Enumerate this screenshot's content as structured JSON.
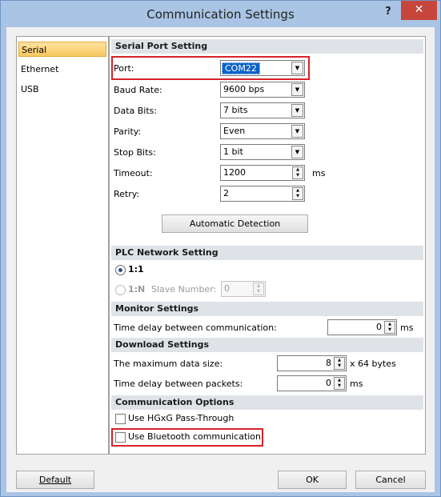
{
  "window": {
    "title": "Communication Settings",
    "help": "?",
    "close": "✕"
  },
  "nav": {
    "items": [
      "Serial",
      "Ethernet",
      "USB"
    ],
    "selected": "Serial"
  },
  "serial": {
    "header": "Serial Port Setting",
    "port_label": "Port:",
    "port_value": "COM22",
    "baud_label": "Baud Rate:",
    "baud_value": "9600 bps",
    "databits_label": "Data Bits:",
    "databits_value": "7 bits",
    "parity_label": "Parity:",
    "parity_value": "Even",
    "stopbits_label": "Stop Bits:",
    "stopbits_value": "1 bit",
    "timeout_label": "Timeout:",
    "timeout_value": "1200",
    "timeout_unit": "ms",
    "retry_label": "Retry:",
    "retry_value": "2",
    "auto_detect_button": "Automatic Detection"
  },
  "plc": {
    "header": "PLC Network Setting",
    "option_1_1": "1:1",
    "option_1_n": "1:N",
    "slave_label": "Slave Number:",
    "slave_value": "0"
  },
  "monitor": {
    "header": "Monitor Settings",
    "delay_label": "Time delay between communication:",
    "delay_value": "0",
    "delay_unit": "ms"
  },
  "download": {
    "header": "Download Settings",
    "max_size_label": "The maximum data size:",
    "max_size_value": "8",
    "max_size_unit": "x 64 bytes",
    "packet_delay_label": "Time delay between packets:",
    "packet_delay_value": "0",
    "packet_delay_unit": "ms"
  },
  "options": {
    "header": "Communication Options",
    "hgxg_label": "Use HGxG Pass-Through",
    "bluetooth_label": "Use Bluetooth communication"
  },
  "footer": {
    "default_button": "Default",
    "ok_button": "OK",
    "cancel_button": "Cancel"
  },
  "colors": {
    "title_bar": "#a9c4e4",
    "close_button": "#c7463b",
    "highlight": "#d7222a",
    "selected_nav": "#f9c860"
  }
}
